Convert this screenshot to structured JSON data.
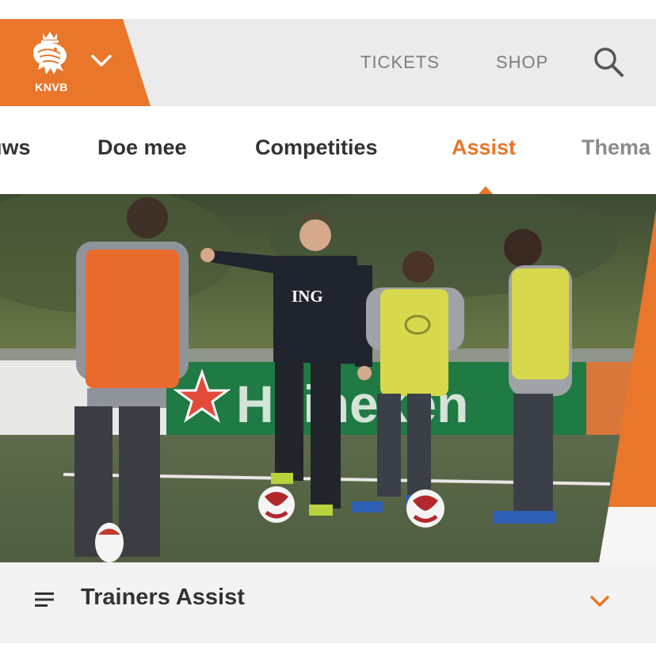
{
  "header": {
    "logo_text": "KNVB",
    "links": [
      "TICKETS",
      "SHOP"
    ],
    "brand_color": "#e9762a"
  },
  "nav": {
    "items": [
      {
        "label": "uws",
        "state": "normal"
      },
      {
        "label": "Doe mee",
        "state": "normal"
      },
      {
        "label": "Competities",
        "state": "normal"
      },
      {
        "label": "Assist",
        "state": "active"
      },
      {
        "label": "Thema",
        "state": "faded"
      }
    ]
  },
  "hero": {
    "banner_text": "Heineken",
    "shirt_text": "ING"
  },
  "subnav": {
    "title": "Trainers Assist"
  }
}
